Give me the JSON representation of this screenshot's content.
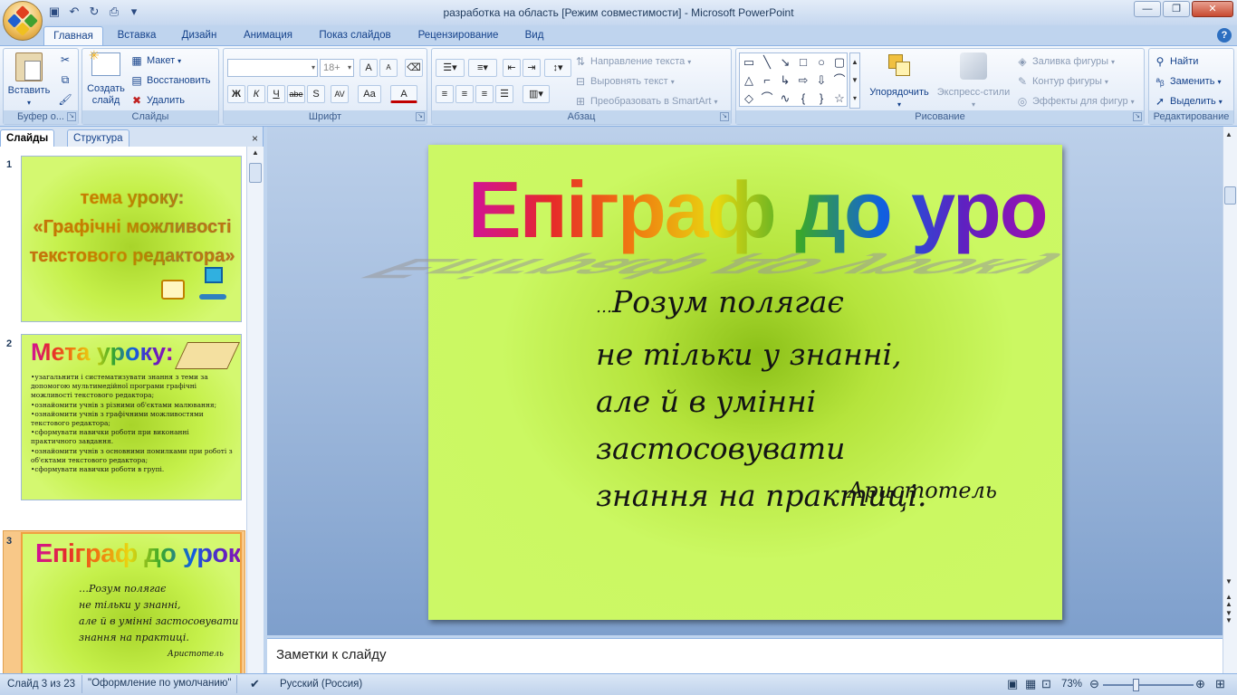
{
  "window": {
    "title": "разработка на область [Режим совместимости] - Microsoft PowerPoint",
    "controls": [
      "—",
      "❐",
      "✕"
    ]
  },
  "qat": [
    "save-icon",
    "undo-icon",
    "redo-icon",
    "preview-icon",
    "customize-icon"
  ],
  "tabs": [
    "Главная",
    "Вставка",
    "Дизайн",
    "Анимация",
    "Показ слайдов",
    "Рецензирование",
    "Вид"
  ],
  "ribbon": {
    "clipboard": {
      "title": "Буфер о...",
      "paste": "Вставить"
    },
    "slides": {
      "title": "Слайды",
      "new_slide": "Создать слайд",
      "layout": "Макет",
      "reset": "Восстановить",
      "delete": "Удалить"
    },
    "font": {
      "title": "Шрифт",
      "font_name": "",
      "font_size": "18+",
      "bold": "Ж",
      "italic": "К",
      "underline": "Ч",
      "strike": "abe",
      "shadow": "S",
      "spacing": "AV",
      "case": "Aa",
      "color": "A",
      "grow": "A",
      "shrink": "A"
    },
    "paragraph": {
      "title": "Абзац",
      "text_direction": "Направление текста",
      "align_text": "Выровнять текст",
      "smartart": "Преобразовать в SmartArt"
    },
    "drawing": {
      "title": "Рисование",
      "arrange": "Упорядочить",
      "quick_styles": "Экспресс-стили",
      "fill": "Заливка фигуры",
      "outline": "Контур фигуры",
      "effects": "Эффекты для фигур"
    },
    "editing": {
      "title": "Редактирование",
      "find": "Найти",
      "replace": "Заменить",
      "select": "Выделить"
    }
  },
  "panel": {
    "tab_slides": "Слайды",
    "tab_outline": "Структура"
  },
  "thumbnails": [
    {
      "number": "1",
      "line1": "тема уроку:",
      "line2": "«Графічні можливості",
      "line3": "текстового редактора»"
    },
    {
      "number": "2",
      "title": "Мета уроку:",
      "bullets": [
        "•узагальнити і систематизувати знання з теми за допомогою мультимедійної програми графічні можливості текстового редактора;",
        "•ознайомити учнів з різними об'єктами малювання;",
        "•ознайомити учнів з графічними можливостями текстового редактора;",
        "•сформувати навички роботи при виконанні практичного завдання.",
        "•ознайомити учнів з основними помилками при роботі з об'єктами текстового редактора;",
        "•сформувати навички роботи в групі."
      ]
    },
    {
      "number": "3",
      "title": "Епіграф до уроку",
      "lines": [
        "…Розум полягає",
        "не тільки у знанні,",
        "але й в умінні застосовувати",
        "знання на практиці."
      ],
      "author": "Аристотель"
    }
  ],
  "slide": {
    "title": "Епіграф до уроку",
    "quote_prefix": "…",
    "quote_line1": "Розум полягає",
    "quote_line2": "не тільки у знанні,",
    "quote_line3": "але й в умінні застосовувати",
    "quote_line4": "знання на практиці.",
    "author": "Аристотель"
  },
  "notes": {
    "placeholder": "Заметки к слайду"
  },
  "status": {
    "slide_of": "Слайд 3 из 23",
    "theme": "\"Оформление по умолчанию\"",
    "language": "Русский (Россия)",
    "zoom": "73%"
  },
  "colors": {
    "slide_bg": "#ccf866",
    "slide_center": "#8cc018",
    "ribbon": "#dfe9f7",
    "accent": "#15428b"
  }
}
